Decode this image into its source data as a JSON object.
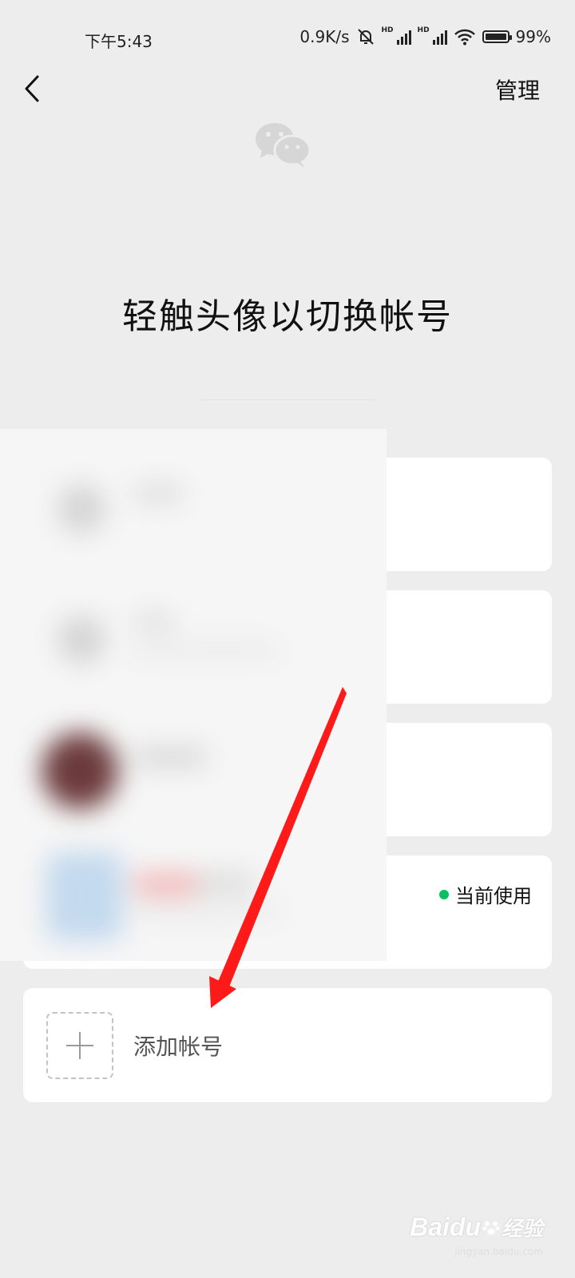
{
  "status_bar": {
    "time": "下午5:43",
    "network_speed": "0.9K/s",
    "hd_label_1": "HD",
    "hd_label_2": "HD",
    "battery_percent": "99%",
    "icons": [
      "mute-bell-icon",
      "signal-icon",
      "signal-icon",
      "wifi-icon",
      "battery-icon"
    ]
  },
  "header": {
    "back_icon": "chevron-left-icon",
    "manage_label": "管理"
  },
  "title": "轻触头像以切换帐号",
  "accounts": {
    "current_badge": "当前使用",
    "current_dot_color": "#07c160"
  },
  "add_account": {
    "label": "添加帐号",
    "icon": "plus-icon"
  },
  "annotation": {
    "arrow_color": "#ff1a1a"
  },
  "watermark": {
    "brand": "Baidu",
    "suffix": "经验",
    "url": "jingyan.baidu.com"
  }
}
